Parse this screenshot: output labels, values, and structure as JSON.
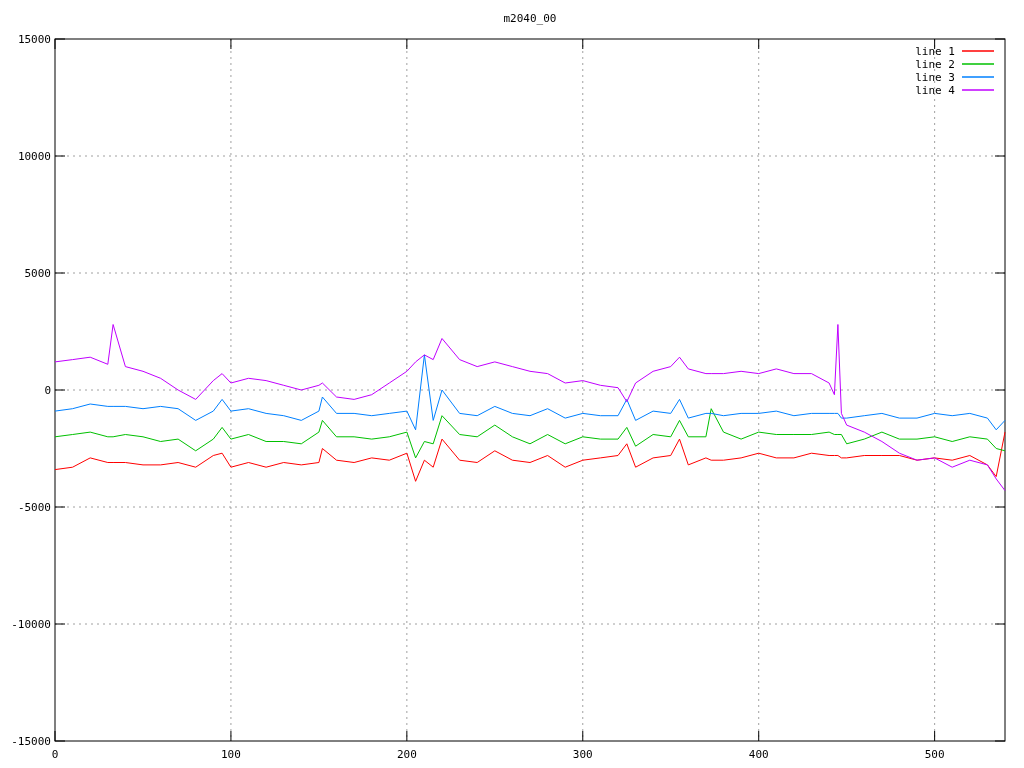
{
  "chart_data": {
    "type": "line",
    "title": "m2040_00",
    "x": [
      0,
      10,
      20,
      30,
      33,
      40,
      50,
      60,
      70,
      80,
      90,
      95,
      100,
      110,
      120,
      130,
      140,
      150,
      152,
      160,
      170,
      180,
      190,
      200,
      205,
      210,
      215,
      220,
      230,
      240,
      250,
      260,
      270,
      280,
      290,
      300,
      310,
      320,
      325,
      330,
      340,
      350,
      355,
      360,
      370,
      373,
      380,
      390,
      400,
      410,
      420,
      430,
      440,
      443,
      445,
      447,
      450,
      460,
      470,
      480,
      490,
      500,
      510,
      520,
      530,
      535,
      540
    ],
    "series": [
      {
        "name": "line 1",
        "color": "#ff0000",
        "values": [
          -3400,
          -3300,
          -2900,
          -3100,
          -3100,
          -3100,
          -3200,
          -3200,
          -3100,
          -3300,
          -2800,
          -2700,
          -3300,
          -3100,
          -3300,
          -3100,
          -3200,
          -3100,
          -2500,
          -3000,
          -3100,
          -2900,
          -3000,
          -2700,
          -3900,
          -3000,
          -3300,
          -2100,
          -3000,
          -3100,
          -2600,
          -3000,
          -3100,
          -2800,
          -3300,
          -3000,
          -2900,
          -2800,
          -2300,
          -3300,
          -2900,
          -2800,
          -2100,
          -3200,
          -2900,
          -3000,
          -3000,
          -2900,
          -2700,
          -2900,
          -2900,
          -2700,
          -2800,
          -2800,
          -2800,
          -2900,
          -2900,
          -2800,
          -2800,
          -2800,
          -3000,
          -2900,
          -3000,
          -2800,
          -3200,
          -3700,
          -1800
        ]
      },
      {
        "name": "line 2",
        "color": "#00c000",
        "values": [
          -2000,
          -1900,
          -1800,
          -2000,
          -2000,
          -1900,
          -2000,
          -2200,
          -2100,
          -2600,
          -2100,
          -1600,
          -2100,
          -1900,
          -2200,
          -2200,
          -2300,
          -1800,
          -1300,
          -2000,
          -2000,
          -2100,
          -2000,
          -1800,
          -2900,
          -2200,
          -2300,
          -1100,
          -1900,
          -2000,
          -1500,
          -2000,
          -2300,
          -1900,
          -2300,
          -2000,
          -2100,
          -2100,
          -1600,
          -2400,
          -1900,
          -2000,
          -1300,
          -2000,
          -2000,
          -800,
          -1800,
          -2100,
          -1800,
          -1900,
          -1900,
          -1900,
          -1800,
          -1900,
          -1900,
          -1900,
          -2300,
          -2100,
          -1800,
          -2100,
          -2100,
          -2000,
          -2200,
          -2000,
          -2100,
          -2500,
          -2600
        ]
      },
      {
        "name": "line 3",
        "color": "#0080ff",
        "values": [
          -900,
          -800,
          -600,
          -700,
          -700,
          -700,
          -800,
          -700,
          -800,
          -1300,
          -900,
          -400,
          -900,
          -800,
          -1000,
          -1100,
          -1300,
          -900,
          -300,
          -1000,
          -1000,
          -1100,
          -1000,
          -900,
          -1700,
          1500,
          -1300,
          0,
          -1000,
          -1100,
          -700,
          -1000,
          -1100,
          -800,
          -1200,
          -1000,
          -1100,
          -1100,
          -400,
          -1300,
          -900,
          -1000,
          -400,
          -1200,
          -1000,
          -1000,
          -1100,
          -1000,
          -1000,
          -900,
          -1100,
          -1000,
          -1000,
          -1000,
          -1000,
          -1200,
          -1200,
          -1100,
          -1000,
          -1200,
          -1200,
          -1000,
          -1100,
          -1000,
          -1200,
          -1700,
          -1300
        ]
      },
      {
        "name": "line 4",
        "color": "#c000ff",
        "values": [
          1200,
          1300,
          1400,
          1100,
          2800,
          1000,
          800,
          500,
          0,
          -400,
          400,
          700,
          300,
          500,
          400,
          200,
          0,
          200,
          300,
          -300,
          -400,
          -200,
          300,
          800,
          1200,
          1500,
          1300,
          2200,
          1300,
          1000,
          1200,
          1000,
          800,
          700,
          300,
          400,
          200,
          100,
          -500,
          300,
          800,
          1000,
          1400,
          900,
          700,
          700,
          700,
          800,
          700,
          900,
          700,
          700,
          300,
          -200,
          2800,
          -1000,
          -1500,
          -1800,
          -2200,
          -2700,
          -3000,
          -2900,
          -3300,
          -3000,
          -3200,
          -3800,
          -4300
        ]
      }
    ],
    "xlim": [
      0,
      540
    ],
    "ylim": [
      -15000,
      15000
    ],
    "xticks": [
      0,
      100,
      200,
      300,
      400,
      500
    ],
    "yticks": [
      -15000,
      -10000,
      -5000,
      0,
      5000,
      10000,
      15000
    ],
    "grid": true,
    "legend": true
  }
}
